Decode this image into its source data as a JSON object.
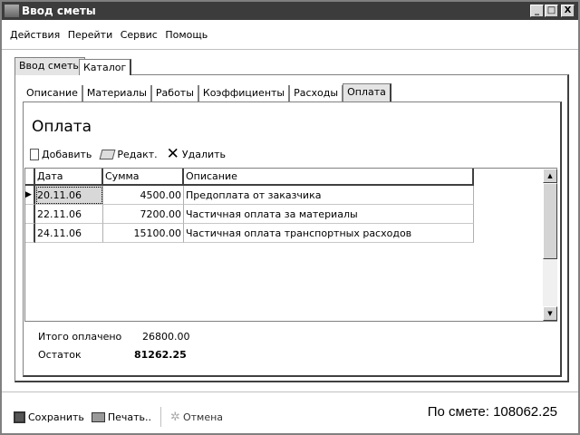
{
  "window": {
    "title": "Ввод сметы",
    "controls": [
      "_",
      "□",
      "X"
    ]
  },
  "menu": [
    "Действия",
    "Перейти",
    "Сервис",
    "Помощь"
  ],
  "outer_tabs": [
    {
      "label": "Ввод сметы",
      "active": true
    },
    {
      "label": "Каталог",
      "active": false
    }
  ],
  "inner_tabs": [
    {
      "label": "Описание"
    },
    {
      "label": "Материалы"
    },
    {
      "label": "Работы"
    },
    {
      "label": "Коэффициенты"
    },
    {
      "label": "Расходы"
    },
    {
      "label": "Оплата",
      "active": true
    }
  ],
  "panel": {
    "title": "Оплата"
  },
  "toolbar": {
    "add": "Добавить",
    "edit": "Редакт.",
    "delete": "Удалить"
  },
  "grid": {
    "columns": [
      "Дата",
      "Сумма",
      "Описание"
    ],
    "rows": [
      {
        "date": "20.11.06",
        "sum": "4500.00",
        "desc": "Предоплата от заказчика"
      },
      {
        "date": "22.11.06",
        "sum": "7200.00",
        "desc": "Частичная оплата за материалы"
      },
      {
        "date": "24.11.06",
        "sum": "15100.00",
        "desc": "Частичная оплата транспортных расходов"
      }
    ]
  },
  "totals": {
    "paid_label": "Итого оплачено",
    "paid_value": "26800.00",
    "rest_label": "Остаток",
    "rest_value": "81262.25"
  },
  "bottom": {
    "save": "Сохранить",
    "print": "Печать..",
    "cancel": "Отмена",
    "estimate": "По смете: 108062.25"
  }
}
